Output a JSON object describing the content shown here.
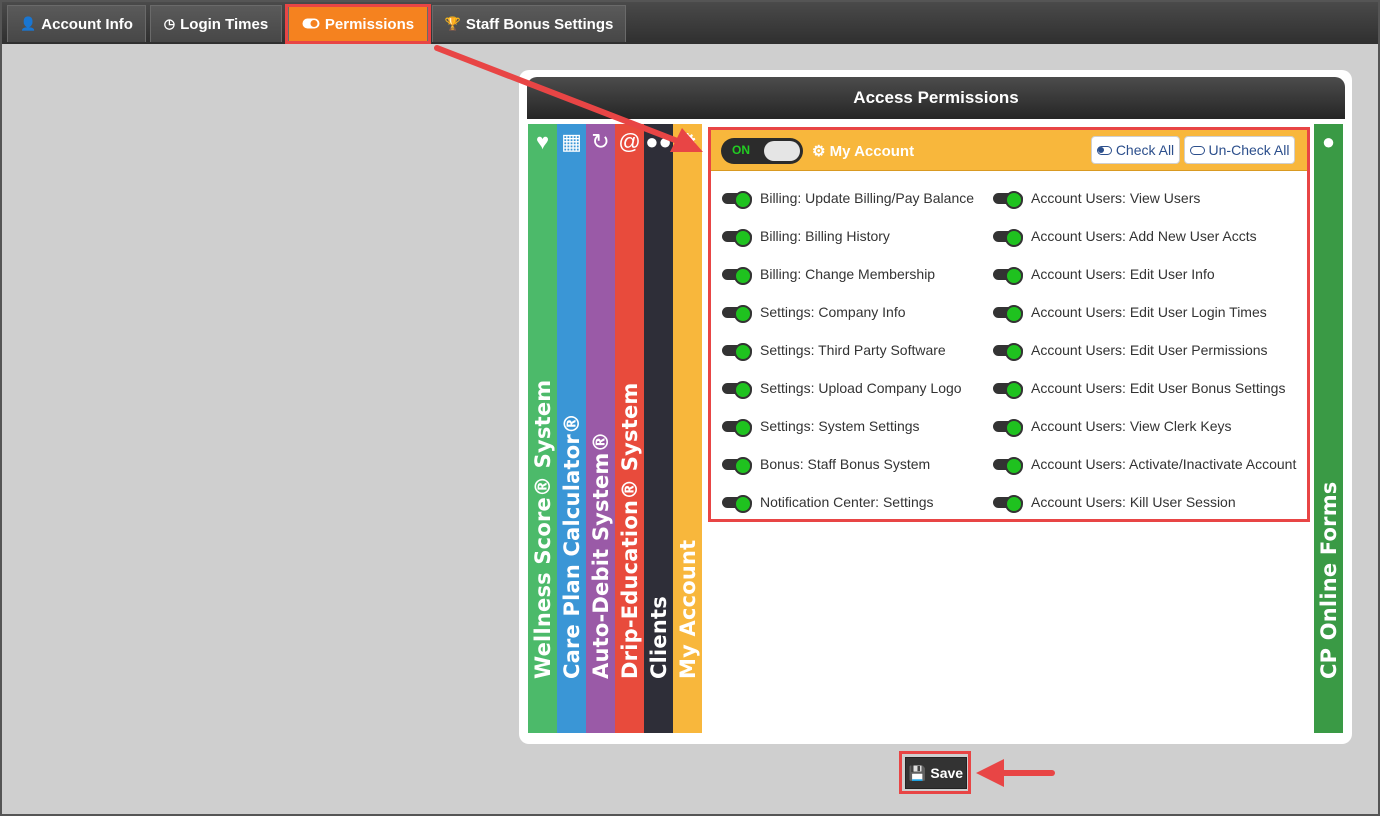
{
  "tabs": [
    {
      "label": "Account Info",
      "icon": "user-icon"
    },
    {
      "label": "Login Times",
      "icon": "clock-icon"
    },
    {
      "label": "Permissions",
      "icon": "toggle-icon"
    },
    {
      "label": "Staff Bonus Settings",
      "icon": "trophy-icon"
    }
  ],
  "panel": {
    "title": "Access Permissions"
  },
  "side_tabs": [
    {
      "label": "Wellness Score® System",
      "icon": "heartbeat-icon",
      "color": "#4cba6a"
    },
    {
      "label": "Care Plan Calculator®",
      "icon": "calculator-icon",
      "color": "#3a96d6"
    },
    {
      "label": "Auto-Debit System®",
      "icon": "refresh-icon",
      "color": "#9a5aa7"
    },
    {
      "label": "Drip-Education® System",
      "icon": "at-icon",
      "color": "#e84b3c"
    },
    {
      "label": "Clients",
      "icon": "users-icon",
      "color": "#2e2e38"
    },
    {
      "label": "My Account",
      "icon": "gear-icon",
      "color": "#f8b73c"
    }
  ],
  "right_tab": {
    "label": "CP Online Forms",
    "icon": "globe-icon",
    "color": "#3a9a45"
  },
  "section": {
    "toggle_label": "ON",
    "title": "My Account",
    "check_all": "Check All",
    "uncheck_all": "Un-Check All"
  },
  "permissions_left": [
    "Billing: Update Billing/Pay Balance",
    "Billing: Billing History",
    "Billing: Change Membership",
    "Settings: Company Info",
    "Settings: Third Party Software",
    "Settings: Upload Company Logo",
    "Settings: System Settings",
    "Bonus: Staff Bonus System",
    "Notification Center: Settings"
  ],
  "permissions_right": [
    "Account Users: View Users",
    "Account Users: Add New User Accts",
    "Account Users: Edit User Info",
    "Account Users: Edit User Login Times",
    "Account Users: Edit User Permissions",
    "Account Users: Edit User Bonus Settings",
    "Account Users: View Clerk Keys",
    "Account Users: Activate/Inactivate Account",
    "Account Users: Kill User Session"
  ],
  "save_label": "Save",
  "colors": {
    "active_tab": "#f5821f",
    "highlight": "#e84545",
    "section_header": "#f8b73c",
    "toggle_on": "#1fc21f"
  }
}
